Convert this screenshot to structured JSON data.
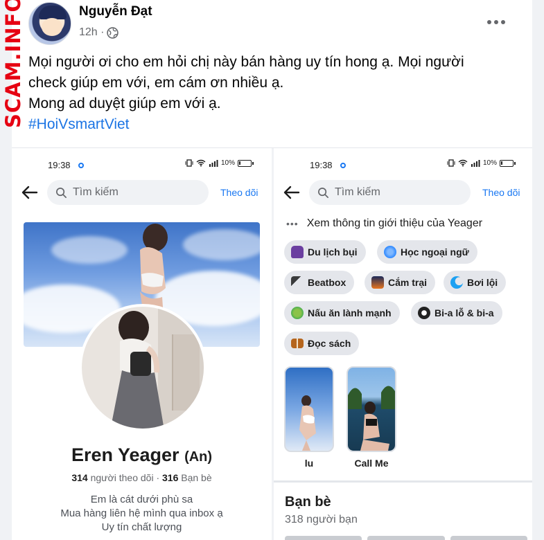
{
  "watermark": {
    "text": "SCAM.INFO"
  },
  "post": {
    "author": "Nguyễn Đạt",
    "time": "12h ·",
    "more_icon": "more-horizontal-icon",
    "lines": [
      "Mọi người ơi cho em hỏi chị này bán hàng uy tín hong ạ. Mọi người",
      "check giúp em với, em cám ơn nhiều ạ.",
      "Mong ad duyệt giúp em với ạ."
    ],
    "hashtag": "#HoiVsmartViet",
    "hashtag_color": "#1b74e4"
  },
  "phone": {
    "status_time": "19:38",
    "battery": "10%",
    "search_placeholder": "Tìm kiếm",
    "follow_label": "Theo dõi",
    "accent": "#1877f2"
  },
  "profile": {
    "name": "Eren Yeager",
    "alt_name": "(An)",
    "followers_count": "314",
    "followers_label": "người theo dõi ·",
    "friends_count": "316",
    "friends_label": "Bạn bè",
    "bio": [
      "Em là cát dưới phù sa",
      "Mua hàng liên hệ mình qua inbox ạ",
      "Uy tín chất lượng"
    ]
  },
  "about": {
    "intro_link": "Xem thông tin giới thiệu của Yeager",
    "interests": [
      {
        "label": "Du lịch bụi",
        "icon": "backpack-icon",
        "color": "#6b3fa0"
      },
      {
        "label": "Học ngoại ngữ",
        "icon": "globe-icon",
        "color": "#2d88ff"
      },
      {
        "label": "Beatbox",
        "icon": "microphone-icon",
        "color": "#3a3b3c"
      },
      {
        "label": "Cắm trại",
        "icon": "campfire-icon",
        "color": "#e8741e"
      },
      {
        "label": "Bơi lội",
        "icon": "wave-icon",
        "color": "#1da1f2"
      },
      {
        "label": "Nấu ăn lành mạnh",
        "icon": "salad-icon",
        "color": "#4caf50"
      },
      {
        "label": "Bi-a lỗ & bi-a",
        "icon": "billiard-ball-icon",
        "color": "#222222"
      },
      {
        "label": "Đọc sách",
        "icon": "book-icon",
        "color": "#b5651d"
      }
    ],
    "featured": [
      {
        "label": "lu"
      },
      {
        "label": "Call Me"
      }
    ],
    "friends_title": "Bạn bè",
    "friends_count_text": "318 người bạn"
  }
}
